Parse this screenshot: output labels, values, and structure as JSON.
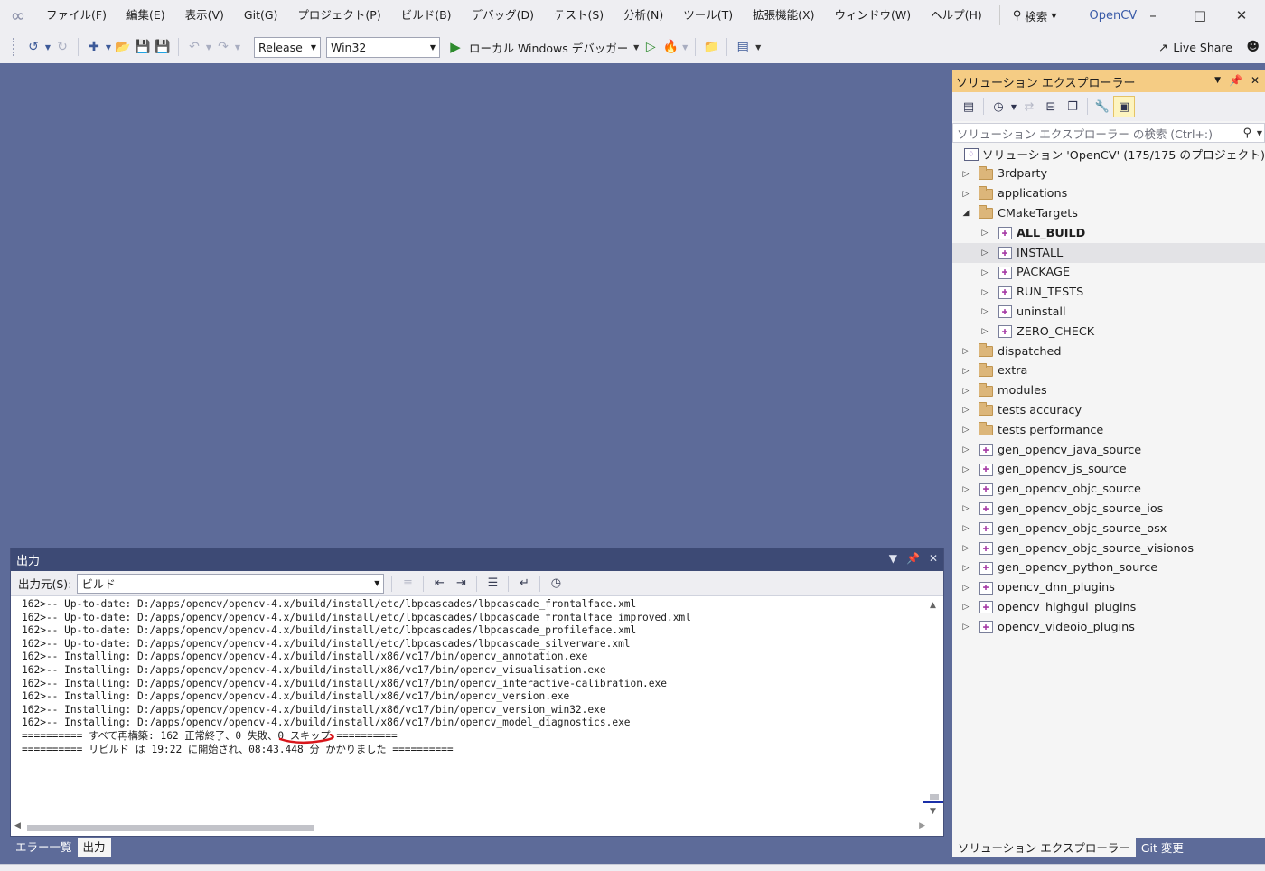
{
  "menu": [
    "ファイル(F)",
    "編集(E)",
    "表示(V)",
    "Git(G)",
    "プロジェクト(P)",
    "ビルド(B)",
    "デバッグ(D)",
    "テスト(S)",
    "分析(N)",
    "ツール(T)",
    "拡張機能(X)",
    "ウィンドウ(W)",
    "ヘルプ(H)"
  ],
  "search_label": "検索",
  "solution_name": "OpenCV",
  "toolbar": {
    "configuration": "Release",
    "platform": "Win32",
    "debugger": "ローカル Windows デバッガー",
    "live_share": "Live Share"
  },
  "output": {
    "title": "出力",
    "source_label": "出力元(S):",
    "source_value": "ビルド",
    "lines": [
      "162>-- Up-to-date: D:/apps/opencv/opencv-4.x/build/install/etc/lbpcascades/lbpcascade_frontalface.xml",
      "162>-- Up-to-date: D:/apps/opencv/opencv-4.x/build/install/etc/lbpcascades/lbpcascade_frontalface_improved.xml",
      "162>-- Up-to-date: D:/apps/opencv/opencv-4.x/build/install/etc/lbpcascades/lbpcascade_profileface.xml",
      "162>-- Up-to-date: D:/apps/opencv/opencv-4.x/build/install/etc/lbpcascades/lbpcascade_silverware.xml",
      "162>-- Installing: D:/apps/opencv/opencv-4.x/build/install/x86/vc17/bin/opencv_annotation.exe",
      "162>-- Installing: D:/apps/opencv/opencv-4.x/build/install/x86/vc17/bin/opencv_visualisation.exe",
      "162>-- Installing: D:/apps/opencv/opencv-4.x/build/install/x86/vc17/bin/opencv_interactive-calibration.exe",
      "162>-- Installing: D:/apps/opencv/opencv-4.x/build/install/x86/vc17/bin/opencv_version.exe",
      "162>-- Installing: D:/apps/opencv/opencv-4.x/build/install/x86/vc17/bin/opencv_version_win32.exe",
      "162>-- Installing: D:/apps/opencv/opencv-4.x/build/install/x86/vc17/bin/opencv_model_diagnostics.exe",
      "========== すべて再構築: 162 正常終了、0 失敗、0 スキップ ==========",
      "========== リビルド は 19:22 に開始され、08:43.448 分 かかりました =========="
    ],
    "tabs": [
      "エラー一覧",
      "出力"
    ]
  },
  "solution_explorer": {
    "title": "ソリューション エクスプローラー",
    "search_placeholder": "ソリューション エクスプローラー の検索 (Ctrl+:)",
    "root": "ソリューション 'OpenCV' (175/175 のプロジェクト)",
    "items": [
      {
        "label": "3rdparty",
        "type": "folder",
        "level": 0,
        "expanded": false
      },
      {
        "label": "applications",
        "type": "folder",
        "level": 0,
        "expanded": false
      },
      {
        "label": "CMakeTargets",
        "type": "folder",
        "level": 0,
        "expanded": true
      },
      {
        "label": "ALL_BUILD",
        "type": "project",
        "level": 1,
        "expanded": false,
        "bold": true
      },
      {
        "label": "INSTALL",
        "type": "project",
        "level": 1,
        "expanded": false,
        "selected": true
      },
      {
        "label": "PACKAGE",
        "type": "project",
        "level": 1,
        "expanded": false
      },
      {
        "label": "RUN_TESTS",
        "type": "project",
        "level": 1,
        "expanded": false
      },
      {
        "label": "uninstall",
        "type": "project",
        "level": 1,
        "expanded": false
      },
      {
        "label": "ZERO_CHECK",
        "type": "project",
        "level": 1,
        "expanded": false
      },
      {
        "label": "dispatched",
        "type": "folder",
        "level": 0,
        "expanded": false
      },
      {
        "label": "extra",
        "type": "folder",
        "level": 0,
        "expanded": false
      },
      {
        "label": "modules",
        "type": "folder",
        "level": 0,
        "expanded": false
      },
      {
        "label": "tests accuracy",
        "type": "folder",
        "level": 0,
        "expanded": false
      },
      {
        "label": "tests performance",
        "type": "folder",
        "level": 0,
        "expanded": false
      },
      {
        "label": "gen_opencv_java_source",
        "type": "project",
        "level": 0,
        "expanded": false
      },
      {
        "label": "gen_opencv_js_source",
        "type": "project",
        "level": 0,
        "expanded": false
      },
      {
        "label": "gen_opencv_objc_source",
        "type": "project",
        "level": 0,
        "expanded": false
      },
      {
        "label": "gen_opencv_objc_source_ios",
        "type": "project",
        "level": 0,
        "expanded": false
      },
      {
        "label": "gen_opencv_objc_source_osx",
        "type": "project",
        "level": 0,
        "expanded": false
      },
      {
        "label": "gen_opencv_objc_source_visionos",
        "type": "project",
        "level": 0,
        "expanded": false
      },
      {
        "label": "gen_opencv_python_source",
        "type": "project",
        "level": 0,
        "expanded": false
      },
      {
        "label": "opencv_dnn_plugins",
        "type": "project",
        "level": 0,
        "expanded": false
      },
      {
        "label": "opencv_highgui_plugins",
        "type": "project",
        "level": 0,
        "expanded": false
      },
      {
        "label": "opencv_videoio_plugins",
        "type": "project",
        "level": 0,
        "expanded": false
      }
    ],
    "tabs": [
      "ソリューション エクスプローラー",
      "Git 変更"
    ]
  }
}
